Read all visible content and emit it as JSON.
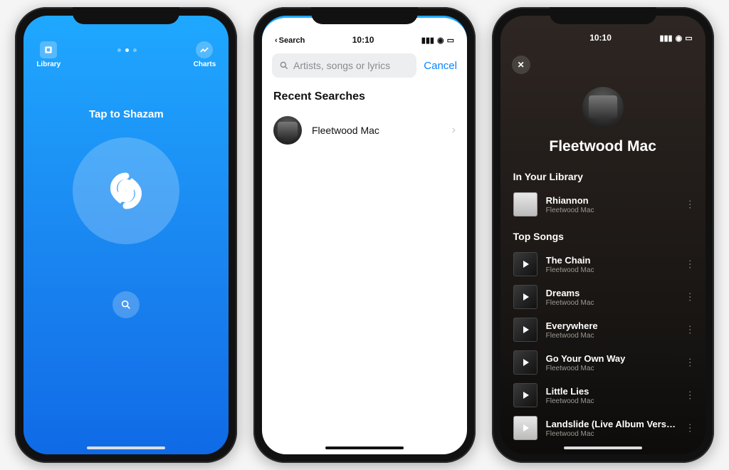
{
  "phone1": {
    "nav": {
      "left_label": "Library",
      "right_label": "Charts"
    },
    "tagline": "Tap to Shazam"
  },
  "phone2": {
    "status": {
      "time": "10:10",
      "back_label": "Search"
    },
    "search": {
      "placeholder": "Artists, songs or lyrics",
      "cancel": "Cancel"
    },
    "section_title": "Recent Searches",
    "recent": [
      {
        "label": "Fleetwood Mac"
      }
    ]
  },
  "phone3": {
    "status": {
      "time": "10:10"
    },
    "artist": "Fleetwood Mac",
    "library_section": "In Your Library",
    "library_songs": [
      {
        "title": "Rhiannon",
        "artist": "Fleetwood Mac",
        "art": "light"
      }
    ],
    "top_section": "Top Songs",
    "top_songs": [
      {
        "title": "The Chain",
        "artist": "Fleetwood Mac"
      },
      {
        "title": "Dreams",
        "artist": "Fleetwood Mac"
      },
      {
        "title": "Everywhere",
        "artist": "Fleetwood Mac"
      },
      {
        "title": "Go Your Own Way",
        "artist": "Fleetwood Mac"
      },
      {
        "title": "Little Lies",
        "artist": "Fleetwood Mac"
      },
      {
        "title": "Landslide (Live Album Version)",
        "artist": "Fleetwood Mac",
        "art": "light"
      }
    ]
  }
}
